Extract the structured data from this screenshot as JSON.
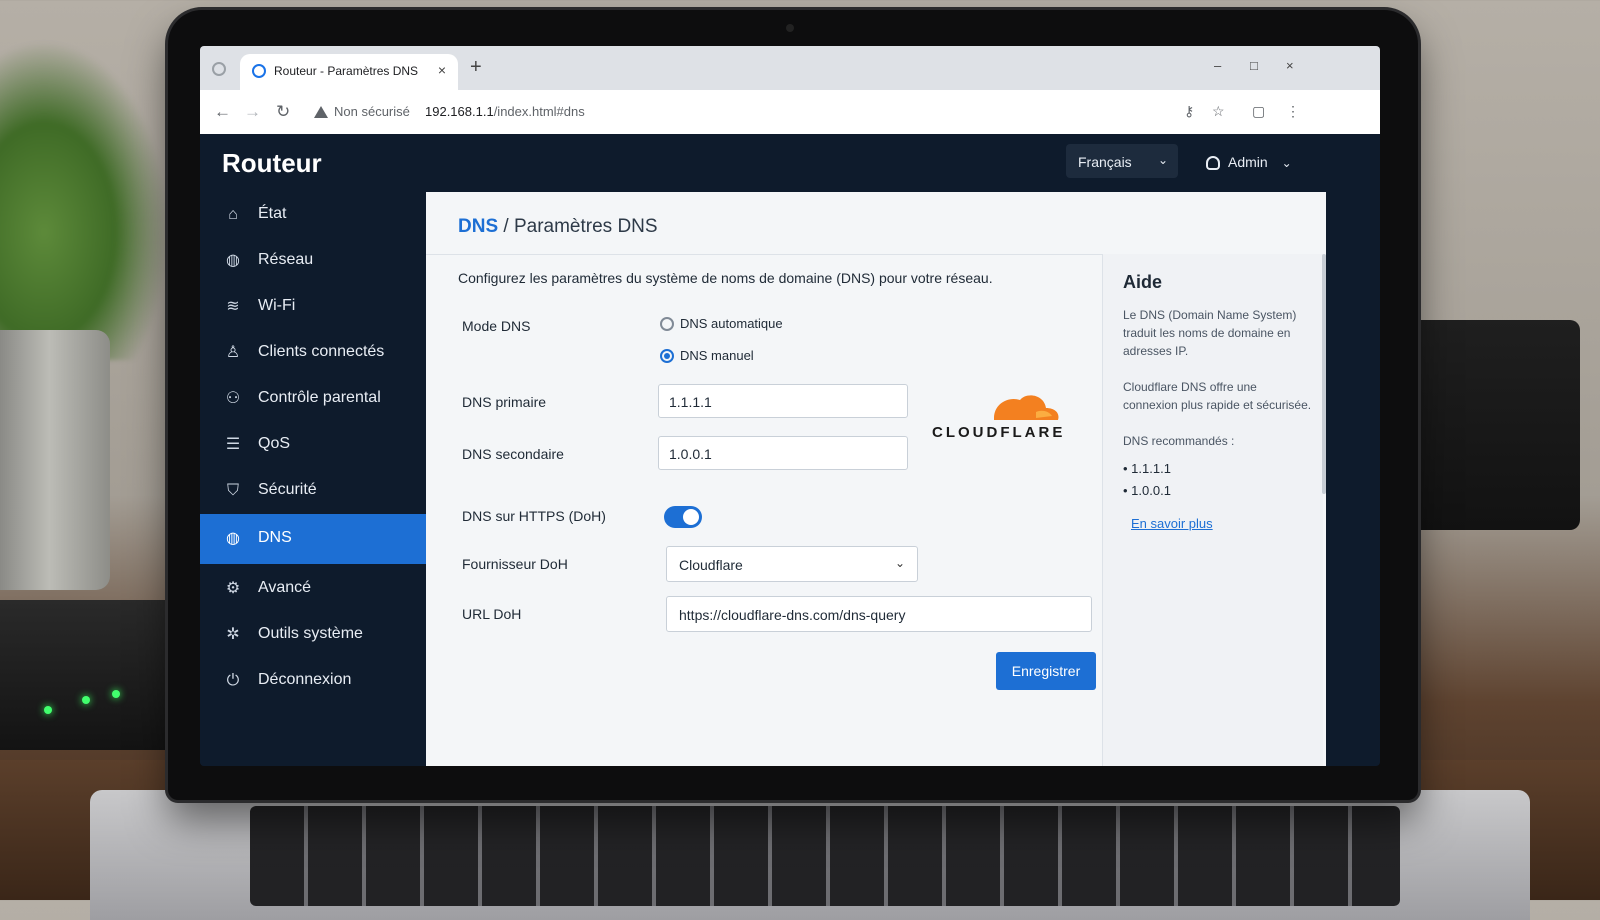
{
  "browser": {
    "tab_title": "Routeur - Paramètres DNS",
    "tab_close": "×",
    "new_tab": "+",
    "security_label": "Non sécurisé",
    "url_host": "192.168.1.1",
    "url_path": "/index.html#dns",
    "window_controls": [
      "–",
      "□",
      "×"
    ]
  },
  "header": {
    "brand": "Routeur",
    "language": "Français",
    "user": "Admin"
  },
  "sidebar": {
    "items": [
      {
        "label": "État",
        "icon": "home-icon",
        "active": false
      },
      {
        "label": "Réseau",
        "icon": "globe-icon",
        "active": false
      },
      {
        "label": "Wi-Fi",
        "icon": "wifi-icon",
        "active": false
      },
      {
        "label": "Clients connectés",
        "icon": "user-icon",
        "active": false
      },
      {
        "label": "Contrôle parental",
        "icon": "users-icon",
        "active": false
      },
      {
        "label": "QoS",
        "icon": "sliders-icon",
        "active": false
      },
      {
        "label": "Sécurité",
        "icon": "shield-icon",
        "active": false
      },
      {
        "label": "DNS",
        "icon": "globe-icon",
        "active": true
      },
      {
        "label": "Avancé",
        "icon": "gear-icon",
        "active": false
      },
      {
        "label": "Outils système",
        "icon": "tools-icon",
        "active": false
      },
      {
        "label": "Déconnexion",
        "icon": "power-icon",
        "active": false
      }
    ]
  },
  "main": {
    "breadcrumb_link": "DNS",
    "breadcrumb_sep": "/",
    "breadcrumb_current": "Paramètres DNS",
    "description": "Configurez les paramètres du système de noms de domaine (DNS) pour votre réseau.",
    "dns_mode_label": "Mode DNS",
    "dns_mode_options": [
      {
        "label": "DNS automatique",
        "checked": false
      },
      {
        "label": "DNS manuel",
        "checked": true
      }
    ],
    "primary_label": "DNS primaire",
    "primary_value": "1.1.1.1",
    "secondary_label": "DNS secondaire",
    "secondary_value": "1.0.0.1",
    "doh_label": "DNS sur HTTPS (DoH)",
    "doh_enabled": true,
    "provider_label": "Fournisseur DoH",
    "provider_value": "Cloudflare",
    "url_label": "URL DoH",
    "url_value": "https://cloudflare-dns.com/dns-query",
    "save_label": "Enregistrer",
    "provider_logo_text": "CLOUDFLARE",
    "logo_color": "#f38020"
  },
  "help": {
    "title": "Aide",
    "text1": "Le DNS (Domain Name System) traduit les noms de domaine en adresses IP.",
    "text2": "Cloudflare DNS offre une connexion plus rapide et sécurisée.",
    "recommended_title": "DNS recommandés :",
    "recommended": [
      "• 1.1.1.1",
      "• 1.0.0.1"
    ],
    "link": "En savoir plus"
  },
  "colors": {
    "accent": "#1d6fd4",
    "sidebar_bg": "#0e1b2c"
  }
}
